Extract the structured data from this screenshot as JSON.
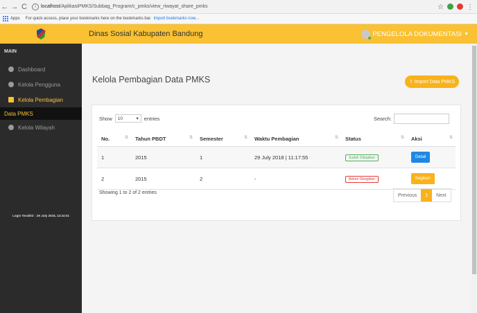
{
  "browser": {
    "url_host": "localhost",
    "url_path": "/AplikasiPMKS/Subbag_Program/c_pmks/view_riwayat_share_pmks",
    "apps_label": "Apps",
    "bookmarks_hint": "For quick access, place your bookmarks here on the bookmarks bar.",
    "import_bookmarks": "Import bookmarks now..."
  },
  "header": {
    "title": "Dinas Sosial Kabupaten Bandung",
    "user": "PENGELOLA DOKUMENTASI"
  },
  "sidebar": {
    "section": "MAIN",
    "items": [
      {
        "label": "Dashboard",
        "icon": "dashboard-icon"
      },
      {
        "label": "Kelola Pengguna",
        "icon": "user-icon"
      },
      {
        "label": "Kelola Pembagian",
        "icon": "table-icon"
      },
      {
        "label": "Kelola Wilayah",
        "icon": "location-icon"
      }
    ],
    "sub_active": "Data PMKS",
    "login_info": "Login Terakhir : 29 July 2018, 13:24:01"
  },
  "page": {
    "title": "Kelola Pembagian Data PMKS",
    "import_button": "Import Data PMKS"
  },
  "table": {
    "show_label": "Show",
    "length_value": "10",
    "entries_label": "entries",
    "search_label": "Search:",
    "columns": [
      "No.",
      "Tahun PBDT",
      "Semester",
      "Waktu Pembagian",
      "Status",
      "Aksi"
    ],
    "rows": [
      {
        "no": "1",
        "tahun": "2015",
        "semester": "1",
        "waktu": "29 July 2018 | 11:17:55",
        "status": "Sudah Dibagikan",
        "aksi": "Detail"
      },
      {
        "no": "2",
        "tahun": "2015",
        "semester": "2",
        "waktu": "-",
        "status": "Belum Dibagikan",
        "aksi": "Bagikan"
      }
    ],
    "info": "Showing 1 to 2 of 2 entries",
    "pagination": {
      "previous": "Previous",
      "current": "1",
      "next": "Next"
    }
  },
  "colors": {
    "accent": "#f9c133",
    "sidebar": "#2b2b2b",
    "detail": "#1e88e5",
    "success": "#4caf50",
    "danger": "#e53935"
  }
}
